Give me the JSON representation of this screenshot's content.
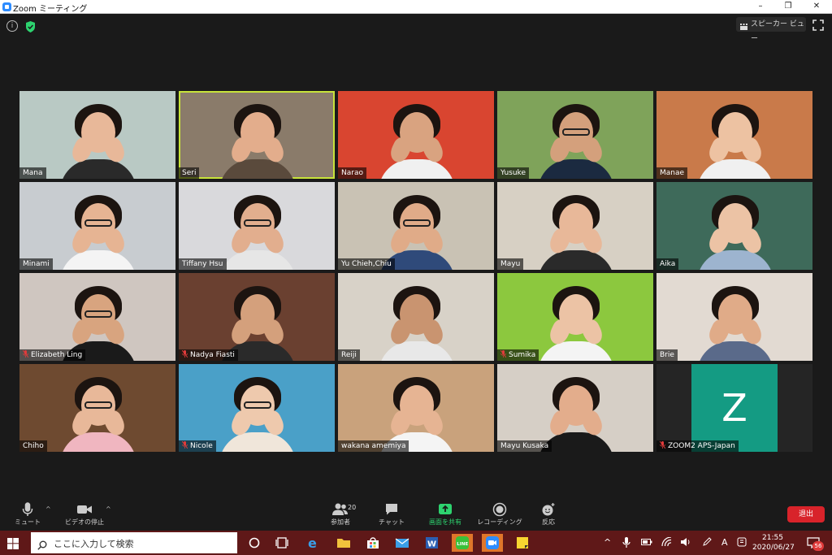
{
  "window": {
    "title": "Zoom ミーティング",
    "controls": [
      "minimize-icon",
      "restore-icon",
      "close-icon"
    ]
  },
  "meeting": {
    "top_left": {
      "info_icon": "info-icon",
      "security_icon": "shield-check-icon"
    },
    "speaker_view_label": "スピーカー ビュー",
    "participants": [
      {
        "name": "Mana",
        "muted": false,
        "active": false,
        "bg": "#b9c9c4",
        "skin": "#e8b899",
        "shirt": "#2a2a2a",
        "glasses": false
      },
      {
        "name": "Seri",
        "muted": false,
        "active": true,
        "bg": "#8a7b6a",
        "skin": "#e3ad8c",
        "shirt": "#5a4a3c",
        "glasses": false
      },
      {
        "name": "Narao",
        "muted": false,
        "active": false,
        "bg": "#d94530",
        "skin": "#d9a380",
        "shirt": "#f0f0f0",
        "glasses": false
      },
      {
        "name": "Yusuke",
        "muted": false,
        "active": false,
        "bg": "#7fa35a",
        "skin": "#d4a07c",
        "shirt": "#1b2a40",
        "glasses": true
      },
      {
        "name": "Manae",
        "muted": false,
        "active": false,
        "bg": "#c97a4a",
        "skin": "#edc2a2",
        "shirt": "#f0f0f0",
        "glasses": false
      },
      {
        "name": "Minami",
        "muted": false,
        "active": false,
        "bg": "#c8ccd0",
        "skin": "#e6b493",
        "shirt": "#f4f4f4",
        "glasses": true
      },
      {
        "name": "Tiffany Hsu",
        "muted": false,
        "active": false,
        "bg": "#d9d9dc",
        "skin": "#e2ae8e",
        "shirt": "#e6e6e6",
        "glasses": true
      },
      {
        "name": "Yu Chieh,Chiu",
        "muted": false,
        "active": false,
        "bg": "#c9c2b4",
        "skin": "#e0ab88",
        "shirt": "#2f4a7a",
        "glasses": true
      },
      {
        "name": "Mayu",
        "muted": false,
        "active": false,
        "bg": "#d7d0c4",
        "skin": "#e8b899",
        "shirt": "#2a2a2a",
        "glasses": false
      },
      {
        "name": "Aika",
        "muted": false,
        "active": false,
        "bg": "#3e6a5a",
        "skin": "#ecc3a5",
        "shirt": "#9db4cf",
        "glasses": false
      },
      {
        "name": "Elizabeth Ling",
        "muted": true,
        "active": false,
        "bg": "#cfc6c0",
        "skin": "#d8a47f",
        "shirt": "#1a1a1a",
        "glasses": true
      },
      {
        "name": "Nadya Fiasti",
        "muted": true,
        "active": false,
        "bg": "#6a4030",
        "skin": "#d4a07c",
        "shirt": "#2a2a2a",
        "glasses": false
      },
      {
        "name": "Reiji",
        "muted": false,
        "active": false,
        "bg": "#d8d2c8",
        "skin": "#c99470",
        "shirt": "#e8e8e8",
        "glasses": false
      },
      {
        "name": "Sumika",
        "muted": true,
        "active": false,
        "bg": "#8cc83e",
        "skin": "#ecc3a5",
        "shirt": "#f4f4f4",
        "glasses": false
      },
      {
        "name": "Brie",
        "muted": false,
        "active": false,
        "bg": "#e2dad2",
        "skin": "#e0ab88",
        "shirt": "#5a6a8a",
        "glasses": false
      },
      {
        "name": "Chiho",
        "muted": false,
        "active": false,
        "bg": "#6e4a30",
        "skin": "#e8b899",
        "shirt": "#f0b6c0",
        "glasses": true
      },
      {
        "name": "Nicole",
        "muted": true,
        "active": false,
        "bg": "#4aa0c8",
        "skin": "#eec9ad",
        "shirt": "#f0e6da",
        "glasses": true
      },
      {
        "name": "wakana amemiya",
        "muted": false,
        "active": false,
        "bg": "#c9a27c",
        "skin": "#e6b493",
        "shirt": "#f4f4f4",
        "glasses": false
      },
      {
        "name": "Mayu Kusaka",
        "muted": false,
        "active": false,
        "bg": "#d6cfc6",
        "skin": "#e3ad8c",
        "shirt": "#1a1a1a",
        "glasses": false
      },
      {
        "name": "ZOOM2 APS-Japan",
        "muted": true,
        "active": false,
        "avatar_letter": "Z",
        "avatar_color": "#149b83"
      }
    ]
  },
  "toolbar": {
    "mute_label": "ミュート",
    "video_label": "ビデオの停止",
    "participants_label": "参加者",
    "participants_count": "20",
    "chat_label": "チャット",
    "share_label": "画面を共有",
    "record_label": "レコーディング",
    "reactions_label": "反応",
    "leave_label": "退出",
    "accent": "#2dd36f",
    "leave_color": "#d8232a"
  },
  "taskbar": {
    "search_placeholder": "ここに入力して検索",
    "apps": [
      "task-view-icon",
      "edge-icon",
      "file-explorer-icon",
      "store-icon",
      "mail-icon",
      "word-icon",
      "line-icon",
      "zoom-icon",
      "sticky-notes-icon"
    ],
    "ime_label": "A",
    "time": "21:55",
    "date": "2020/06/27",
    "notification_count": "56",
    "color": "#5f1818"
  }
}
